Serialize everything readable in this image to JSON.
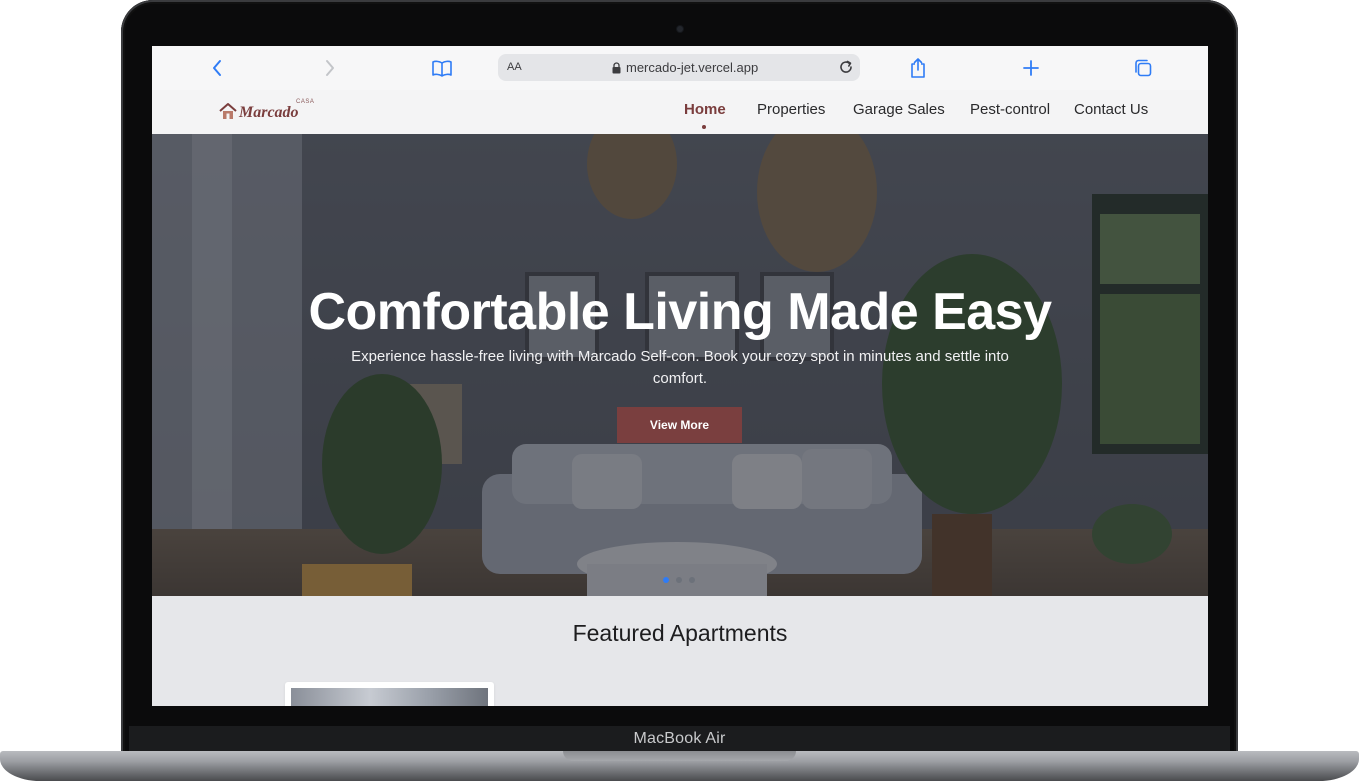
{
  "device": {
    "label": "MacBook Air"
  },
  "browser": {
    "text_size_label": "AA",
    "url": "mercado-jet.vercel.app",
    "icons": [
      "chevron-left-icon",
      "chevron-right-icon",
      "book-icon",
      "lock-icon",
      "reload-icon",
      "share-icon",
      "plus-icon",
      "tabs-icon"
    ]
  },
  "site": {
    "logo": {
      "text": "Marcado",
      "sup": "CASA"
    },
    "nav": [
      {
        "label": "Home",
        "active": true
      },
      {
        "label": "Properties",
        "active": false
      },
      {
        "label": "Garage Sales",
        "active": false
      },
      {
        "label": "Pest-control",
        "active": false
      },
      {
        "label": "Contact Us",
        "active": false
      }
    ],
    "hero": {
      "title": "Comfortable Living Made Easy",
      "subtitle": "Experience hassle-free living with Marcado Self-con. Book your cozy spot in minutes and settle into comfort.",
      "button_label": "View More",
      "slides": 3,
      "active_slide": 1
    },
    "featured": {
      "title": "Featured Apartments"
    }
  },
  "colors": {
    "brand": "#7a3d3d",
    "button": "#7a3f3f",
    "browser_accent": "#2f7cf6",
    "active_dot": "#2f7cf6"
  }
}
